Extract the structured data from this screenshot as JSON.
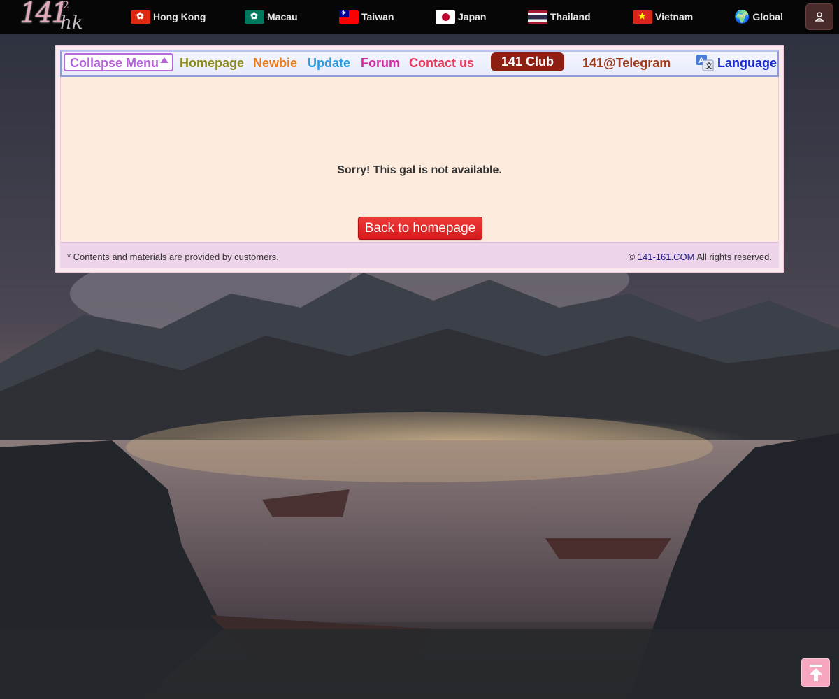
{
  "logo": {
    "number": "141",
    "superscript": "2",
    "suffix": "hk"
  },
  "regions": [
    {
      "label": "Hong Kong",
      "flag": "hk"
    },
    {
      "label": "Macau",
      "flag": "mo"
    },
    {
      "label": "Taiwan",
      "flag": "tw"
    },
    {
      "label": "Japan",
      "flag": "jp"
    },
    {
      "label": "Thailand",
      "flag": "th"
    },
    {
      "label": "Vietnam",
      "flag": "vn"
    },
    {
      "label": "Global",
      "flag": "globe"
    }
  ],
  "user_icon": "user-icon",
  "menu": {
    "collapse_label": "Collapse Menu",
    "homepage": "Homepage",
    "newbie": "Newbie",
    "update": "Update",
    "forum": "Forum",
    "contact": "Contact us",
    "club": "141 Club",
    "telegram": "141@Telegram",
    "language": "Language"
  },
  "colors": {
    "homepage": "#8a8a1a",
    "newbie": "#e87a1a",
    "update": "#2a9be0",
    "forum": "#d02aa0",
    "contact": "#e83a5a",
    "telegram": "#a03a1a",
    "language": "#1a2ad0",
    "club_bg": "#8e1d12"
  },
  "main": {
    "message": "Sorry! This gal is not available.",
    "back_button": "Back to homepage"
  },
  "footer": {
    "note": "* Contents and materials are provided by customers.",
    "copyright_symbol": "©",
    "site": "141-161.COM",
    "rights": "All rights reserved."
  }
}
